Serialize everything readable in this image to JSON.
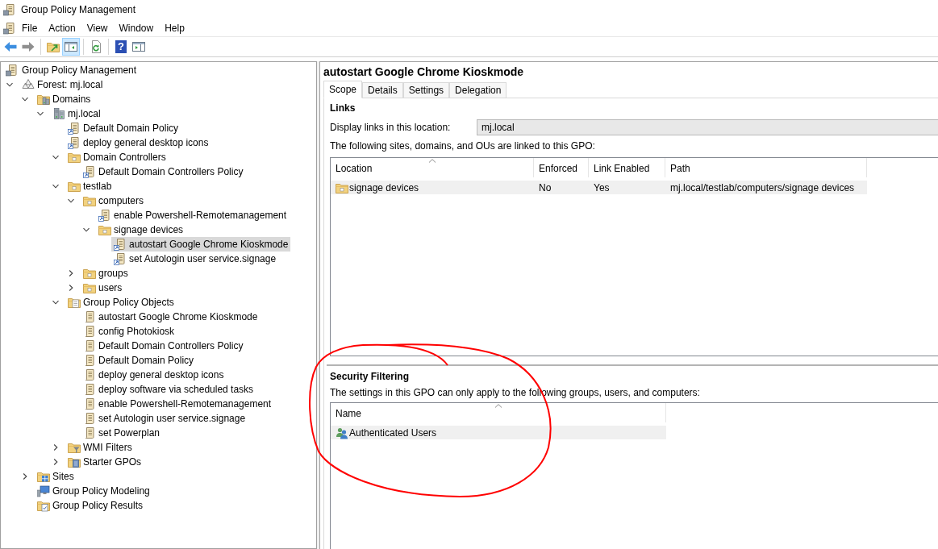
{
  "window": {
    "title": "Group Policy Management"
  },
  "menu": [
    "File",
    "Action",
    "View",
    "Window",
    "Help"
  ],
  "toolbar": [
    {
      "kind": "back",
      "pressed": false,
      "disabled": false
    },
    {
      "kind": "forward",
      "pressed": false,
      "disabled": true
    },
    {
      "kind": "separator"
    },
    {
      "kind": "up",
      "pressed": false,
      "disabled": false
    },
    {
      "kind": "console-tree",
      "pressed": true,
      "disabled": false
    },
    {
      "kind": "separator"
    },
    {
      "kind": "refresh",
      "pressed": false,
      "disabled": false
    },
    {
      "kind": "separator"
    },
    {
      "kind": "help",
      "label": "?",
      "pressed": false,
      "disabled": false
    },
    {
      "kind": "action-pane",
      "pressed": false,
      "disabled": false
    }
  ],
  "tree": {
    "root": {
      "label": "Group Policy Management",
      "kind": "console",
      "selected": false
    },
    "items": [
      {
        "label": "Forest: mj.local",
        "kind": "forest",
        "expanded": true,
        "selected": false,
        "children": [
          {
            "label": "Domains",
            "kind": "domains",
            "expanded": true,
            "selected": false,
            "children": [
              {
                "label": "mj.local",
                "kind": "domain",
                "expanded": true,
                "selected": false,
                "children": [
                  {
                    "label": "Default Domain Policy",
                    "kind": "gpo-link",
                    "selected": false
                  },
                  {
                    "label": "deploy general desktop icons",
                    "kind": "gpo-link",
                    "selected": false
                  },
                  {
                    "label": "Domain Controllers",
                    "kind": "ou",
                    "expanded": true,
                    "selected": false,
                    "children": [
                      {
                        "label": "Default Domain Controllers Policy",
                        "kind": "gpo-link",
                        "selected": false
                      }
                    ]
                  },
                  {
                    "label": "testlab",
                    "kind": "ou",
                    "expanded": true,
                    "selected": false,
                    "children": [
                      {
                        "label": "computers",
                        "kind": "ou",
                        "expanded": true,
                        "selected": false,
                        "children": [
                          {
                            "label": "enable Powershell-Remotemanagement",
                            "kind": "gpo-link",
                            "selected": false
                          },
                          {
                            "label": "signage devices",
                            "kind": "ou",
                            "expanded": true,
                            "selected": false,
                            "children": [
                              {
                                "label": "autostart Google Chrome Kioskmode",
                                "kind": "gpo-link",
                                "selected": true
                              },
                              {
                                "label": "set Autologin user service.signage",
                                "kind": "gpo-link",
                                "selected": false
                              }
                            ]
                          }
                        ]
                      },
                      {
                        "label": "groups",
                        "kind": "ou",
                        "expanded": false,
                        "selected": false
                      },
                      {
                        "label": "users",
                        "kind": "ou",
                        "expanded": false,
                        "selected": false
                      }
                    ]
                  },
                  {
                    "label": "Group Policy Objects",
                    "kind": "gpo-container",
                    "expanded": true,
                    "selected": false,
                    "children": [
                      {
                        "label": "autostart Google Chrome Kioskmode",
                        "kind": "gpo",
                        "selected": false
                      },
                      {
                        "label": "config Photokiosk",
                        "kind": "gpo",
                        "selected": false
                      },
                      {
                        "label": "Default Domain Controllers Policy",
                        "kind": "gpo",
                        "selected": false
                      },
                      {
                        "label": "Default Domain Policy",
                        "kind": "gpo",
                        "selected": false
                      },
                      {
                        "label": "deploy general desktop icons",
                        "kind": "gpo",
                        "selected": false
                      },
                      {
                        "label": "deploy software via scheduled tasks",
                        "kind": "gpo",
                        "selected": false
                      },
                      {
                        "label": "enable Powershell-Remotemanagement",
                        "kind": "gpo",
                        "selected": false
                      },
                      {
                        "label": "set Autologin user service.signage",
                        "kind": "gpo",
                        "selected": false
                      },
                      {
                        "label": "set Powerplan",
                        "kind": "gpo",
                        "selected": false
                      }
                    ]
                  },
                  {
                    "label": "WMI Filters",
                    "kind": "wmi",
                    "expanded": false,
                    "selected": false
                  },
                  {
                    "label": "Starter GPOs",
                    "kind": "starter",
                    "expanded": false,
                    "selected": false
                  }
                ]
              }
            ]
          },
          {
            "label": "Sites",
            "kind": "sites",
            "expanded": false,
            "selected": false
          },
          {
            "label": "Group Policy Modeling",
            "kind": "modeling",
            "selected": false
          },
          {
            "label": "Group Policy Results",
            "kind": "results",
            "selected": false
          }
        ]
      }
    ]
  },
  "details": {
    "title": "autostart Google Chrome Kioskmode",
    "tabs": [
      {
        "label": "Scope",
        "selected": true
      },
      {
        "label": "Details",
        "selected": false
      },
      {
        "label": "Settings",
        "selected": false
      },
      {
        "label": "Delegation",
        "selected": false
      }
    ],
    "links": {
      "heading": "Links",
      "location_label": "Display links in this location:",
      "location_value": "mj.local",
      "caption": "The following sites, domains, and OUs are linked to this GPO:",
      "columns": [
        {
          "label": "Location",
          "sorted": true
        },
        {
          "label": "Enforced",
          "sorted": false
        },
        {
          "label": "Link Enabled",
          "sorted": false
        },
        {
          "label": "Path",
          "sorted": false
        }
      ],
      "rows": [
        {
          "kind": "ou",
          "selected": true,
          "cells": [
            "signage devices",
            "No",
            "Yes",
            "mj.local/testlab/computers/signage devices"
          ]
        }
      ]
    },
    "security_filtering": {
      "heading": "Security Filtering",
      "caption": "The settings in this GPO can only apply to the following groups, users, and computers:",
      "columns": [
        {
          "label": "Name",
          "sorted": true
        }
      ],
      "rows": [
        {
          "kind": "users",
          "selected": true,
          "cells": [
            "Authenticated Users"
          ]
        }
      ]
    }
  }
}
